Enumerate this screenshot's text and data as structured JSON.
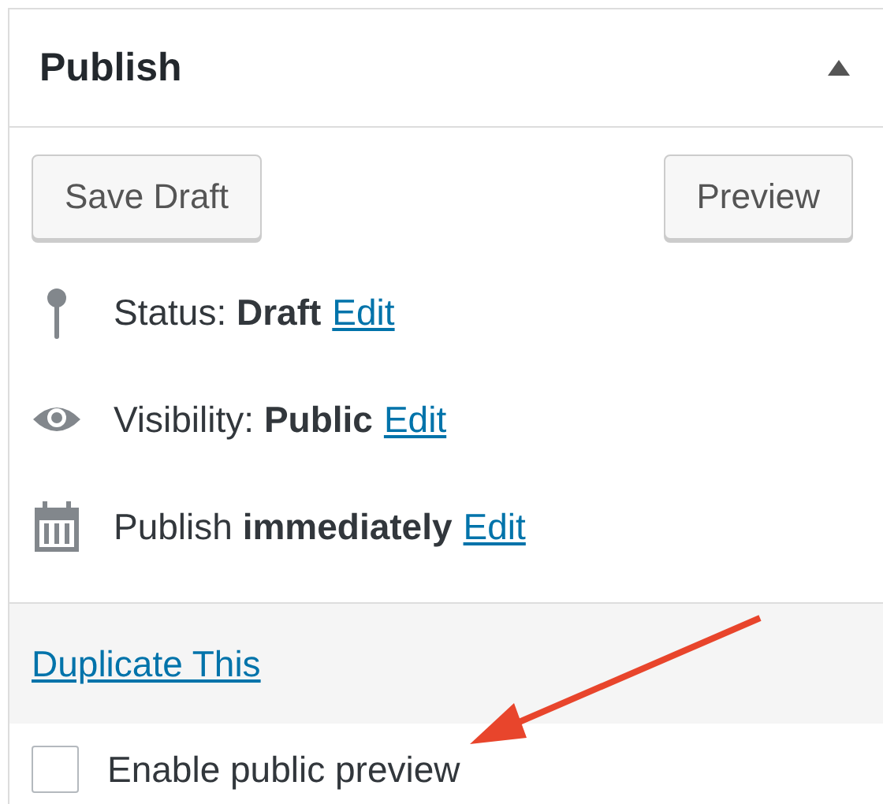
{
  "panel": {
    "title": "Publish",
    "expanded": true
  },
  "buttons": [
    {
      "label": "Save Draft"
    },
    {
      "label": "Preview"
    }
  ],
  "rows": [
    {
      "kind": "status",
      "text": "Status: **Draft**",
      "link": "Edit"
    },
    {
      "kind": "visibility",
      "text": "Visibility: **Public**",
      "link": "Edit"
    },
    {
      "kind": "schedule",
      "text": "Publish **immediately**",
      "link": "Edit"
    }
  ],
  "duplicate_link": "Duplicate This",
  "public_preview": {
    "label": "Enable public preview",
    "checked": false
  }
}
